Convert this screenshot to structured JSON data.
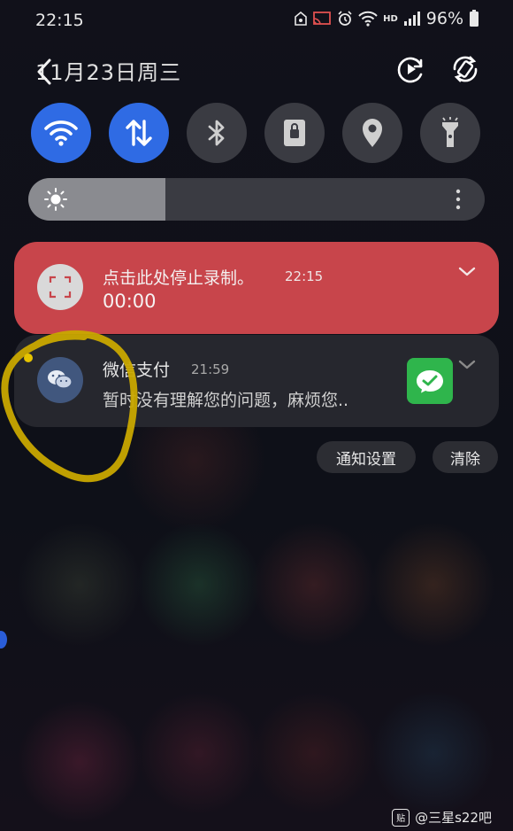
{
  "status_bar": {
    "time": "22:15",
    "network_label": "HD",
    "battery": "96%"
  },
  "header": {
    "date": "11月23日周三",
    "icons": [
      "back-icon",
      "screen-recorder-icon",
      "auto-rotate-icon"
    ]
  },
  "quick_settings": [
    {
      "name": "wifi",
      "icon": "wifi-icon",
      "active": true
    },
    {
      "name": "mobile-data",
      "icon": "data-transfer-icon",
      "active": true
    },
    {
      "name": "bluetooth",
      "icon": "bluetooth-icon",
      "active": false
    },
    {
      "name": "screen-lock",
      "icon": "lock-icon",
      "active": false
    },
    {
      "name": "location",
      "icon": "location-icon",
      "active": false
    },
    {
      "name": "flashlight",
      "icon": "flashlight-icon",
      "active": false
    }
  ],
  "brightness": {
    "level": 0.3,
    "icon": "sun-icon"
  },
  "notifications": {
    "recording": {
      "title": "点击此处停止录制。",
      "time": "22:15",
      "timer": "00:00",
      "color": "#c8454b"
    },
    "wechat": {
      "title": "微信支付",
      "time": "21:59",
      "message": "暂时没有理解您的问题，麻烦您..",
      "thumb_color": "#2fb54c"
    }
  },
  "actions": {
    "settings_label": "通知设置",
    "clear_label": "清除"
  },
  "watermark": {
    "logo": "贴",
    "text": "@三星s22吧"
  },
  "colors": {
    "accent": "#2f6be4",
    "tile_off": "#3a3b42",
    "annotation": "#c9a800"
  }
}
